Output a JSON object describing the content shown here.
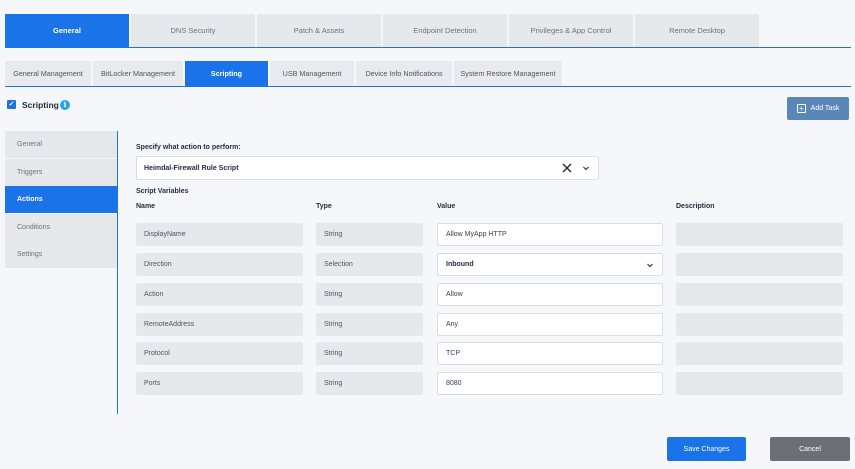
{
  "top_tabs": [
    "General",
    "DNS Security",
    "Patch & Assets",
    "Endpoint Detection",
    "Privileges & App Control",
    "Remote Desktop"
  ],
  "sub_tabs": [
    "General Management",
    "BitLocker Management",
    "Scripting",
    "USB Management",
    "Device Info Notifications",
    "System Restore Management"
  ],
  "header": {
    "title": "Scripting",
    "checkbox": "✓",
    "info": "i",
    "add_task": "Add Task",
    "add_icon": "+"
  },
  "side_menu": [
    "General",
    "Triggers",
    "Actions",
    "Conditions",
    "Settings"
  ],
  "action": {
    "label": "Specify what action to perform:",
    "value": "Heimdal-Firewall Rule Script"
  },
  "variables": {
    "section_label": "Script Variables",
    "columns": [
      "Name",
      "Type",
      "Value",
      "Description"
    ],
    "rows": [
      {
        "name": "DisplayName",
        "type": "String",
        "value": "Allow MyApp HTTP",
        "description": ""
      },
      {
        "name": "Direction",
        "type": "Selection",
        "value": "Inbound",
        "description": ""
      },
      {
        "name": "Action",
        "type": "String",
        "value": "Allow",
        "description": ""
      },
      {
        "name": "RemoteAddress",
        "type": "String",
        "value": "Any",
        "description": ""
      },
      {
        "name": "Protocol",
        "type": "String",
        "value": "TCP",
        "description": ""
      },
      {
        "name": "Ports",
        "type": "String",
        "value": "8080",
        "description": ""
      }
    ]
  },
  "footer": {
    "save": "Save Changes",
    "cancel": "Cancel"
  },
  "colors": {
    "accent": "#1a73e8",
    "add_task_bg": "#5b86b8",
    "cancel_bg": "#6b7078",
    "info_bg": "#2aa3e6"
  }
}
